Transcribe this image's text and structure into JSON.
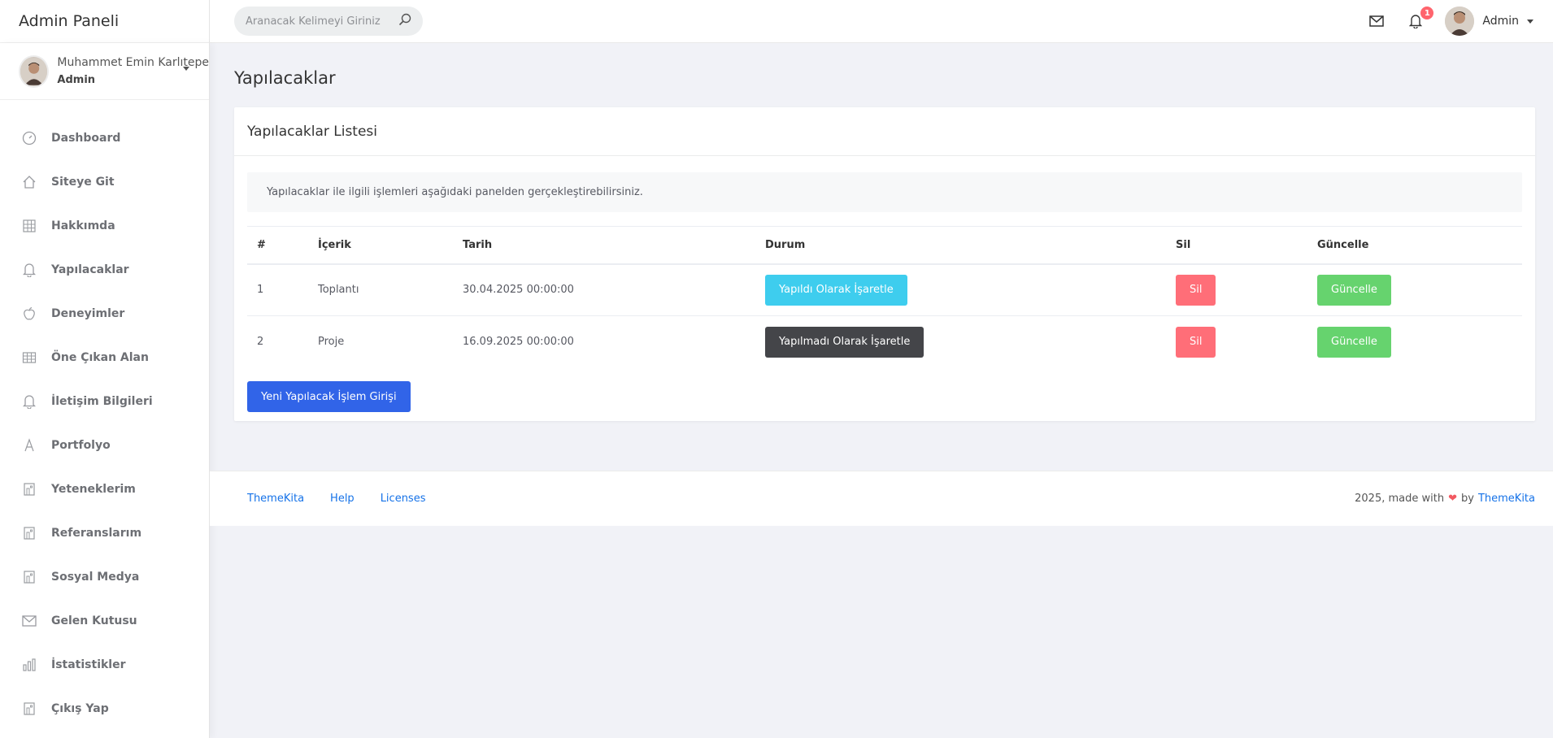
{
  "brand": "Admin Paneli",
  "search": {
    "placeholder": "Aranacak Kelimeyi Giriniz"
  },
  "topbar": {
    "notifications_count": "1",
    "user_name": "Admin"
  },
  "sidebar": {
    "user": {
      "name": "Muhammet Emin Karlıtepe",
      "role": "Admin"
    },
    "items": [
      {
        "label": "Dashboard",
        "icon": "dashboard-icon"
      },
      {
        "label": "Siteye Git",
        "icon": "home-icon"
      },
      {
        "label": "Hakkımda",
        "icon": "grid-icon"
      },
      {
        "label": "Yapılacaklar",
        "icon": "bell-icon"
      },
      {
        "label": "Deneyimler",
        "icon": "apple-icon"
      },
      {
        "label": "Öne Çıkan Alan",
        "icon": "table-icon"
      },
      {
        "label": "İletişim Bilgileri",
        "icon": "bell-icon"
      },
      {
        "label": "Portfolyo",
        "icon": "font-icon"
      },
      {
        "label": "Yeteneklerim",
        "icon": "building-icon"
      },
      {
        "label": "Referanslarım",
        "icon": "building-icon"
      },
      {
        "label": "Sosyal Medya",
        "icon": "building-icon"
      },
      {
        "label": "Gelen Kutusu",
        "icon": "mail-icon"
      },
      {
        "label": "İstatistikler",
        "icon": "chart-icon"
      },
      {
        "label": "Çıkış Yap",
        "icon": "building-icon"
      }
    ]
  },
  "main": {
    "page_title": "Yapılacaklar",
    "card_title": "Yapılacaklar Listesi",
    "alert": "Yapılacaklar ile ilgili işlemleri aşağıdaki panelden gerçekleştirebilirsiniz.",
    "table": {
      "headers": [
        "#",
        "İçerik",
        "Tarih",
        "Durum",
        "Sil",
        "Güncelle"
      ],
      "rows": [
        {
          "id": "1",
          "content": "Toplantı",
          "date": "30.04.2025 00:00:00",
          "status_button": "Yapıldı Olarak İşaretle",
          "delete_button": "Sil",
          "update_button": "Güncelle"
        },
        {
          "id": "2",
          "content": "Proje",
          "date": "16.09.2025 00:00:00",
          "status_button": "Yapılmadı Olarak İşaretle",
          "delete_button": "Sil",
          "update_button": "Güncelle"
        }
      ]
    },
    "new_button": "Yeni Yapılacak İşlem Girişi"
  },
  "footer": {
    "links": [
      "ThemeKita",
      "Help",
      "Licenses"
    ],
    "copy_prefix": "2025, made with",
    "copy_by": "by",
    "copy_link": "ThemeKita"
  },
  "colors": {
    "primary": "#3164e8",
    "info": "#3ecdee",
    "danger": "#ff6e78",
    "success": "#66d36e",
    "dark": "#444549",
    "link": "#1572e8"
  }
}
